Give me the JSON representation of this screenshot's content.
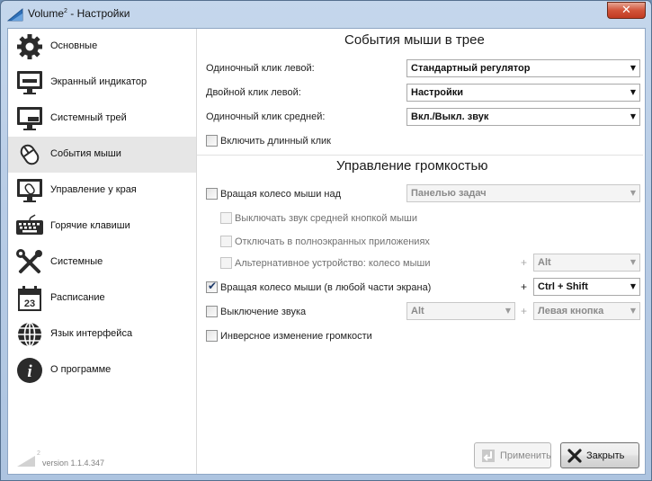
{
  "window": {
    "title": "Volume",
    "title_sup": "2",
    "title_suffix": " - Настройки",
    "close_glyph": "✕"
  },
  "sidebar": {
    "items": [
      {
        "label": "Основные",
        "icon": "gear-icon"
      },
      {
        "label": "Экранный индикатор",
        "icon": "monitor-icon"
      },
      {
        "label": "Системный трей",
        "icon": "system-tray-icon"
      },
      {
        "label": "События мыши",
        "icon": "mouse-icon",
        "active": true
      },
      {
        "label": "Управление у края",
        "icon": "screen-edge-mouse-icon"
      },
      {
        "label": "Горячие клавиши",
        "icon": "keyboard-icon"
      },
      {
        "label": "Системные",
        "icon": "tools-icon"
      },
      {
        "label": "Расписание",
        "icon": "calendar-icon",
        "calendar_day": "23"
      },
      {
        "label": "Язык интерфейса",
        "icon": "globe-icon"
      },
      {
        "label": "О программе",
        "icon": "info-icon",
        "glyph": "i"
      }
    ],
    "logo_text": "2",
    "version": "version 1.1.4.347"
  },
  "mouse_events": {
    "title": "События мыши в трее",
    "rows": [
      {
        "label": "Одиночный клик левой:",
        "value": "Стандартный регулятор"
      },
      {
        "label": "Двойной клик левой:",
        "value": "Настройки"
      },
      {
        "label": "Одиночный клик средней:",
        "value": "Вкл./Выкл. звук"
      }
    ],
    "long_click": {
      "label": "Включить длинный клик",
      "checked": false
    }
  },
  "volume": {
    "title": "Управление громкостью",
    "wheel_over": {
      "label": "Вращая колесо мыши над",
      "checked": false,
      "value": "Панелью задач"
    },
    "mute_middle": {
      "label": "Выключать звук средней кнопкой мыши",
      "checked": false
    },
    "fullscreen": {
      "label": "Отключать в полноэкранных приложениях",
      "checked": false
    },
    "alt_device": {
      "label": "Альтернативное устройство: колесо мыши",
      "checked": false,
      "plus": "+",
      "value": "Alt"
    },
    "wheel_anywhere": {
      "label": "Вращая колесо мыши (в любой части экрана)",
      "checked": true,
      "plus": "+",
      "value": "Ctrl + Shift"
    },
    "mute": {
      "label": "Выключение звука",
      "checked": false,
      "mod_value": "Alt",
      "plus": "+",
      "button_value": "Левая кнопка"
    },
    "inverse": {
      "label": "Инверсное изменение громкости",
      "checked": false
    }
  },
  "buttons": {
    "apply": "Применить",
    "close": "Закрыть"
  },
  "glyphs": {
    "dropdown_arrow": "▼",
    "checkmark": "✔"
  },
  "colors": {
    "title_bar": "#b9cde6",
    "close_button": "#d2543a",
    "active_item": "#e6e6e6"
  }
}
